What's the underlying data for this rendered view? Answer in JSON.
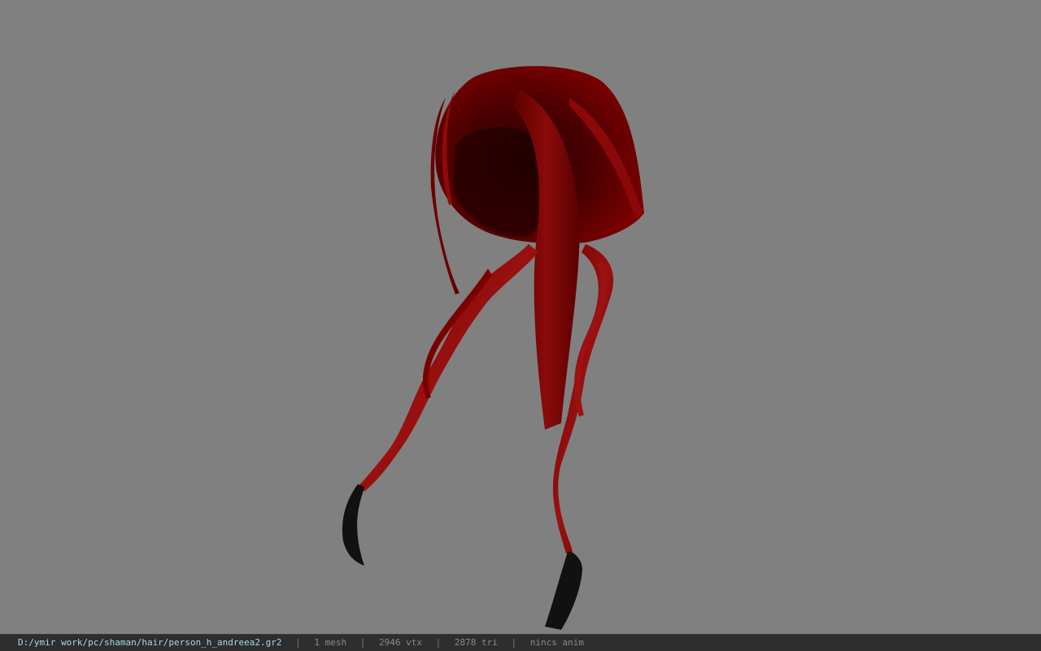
{
  "viewer": {
    "background_color": "#808080",
    "model": {
      "hair_color": "#7a0000",
      "tip_color": "#111111"
    }
  },
  "statusbar": {
    "file_path": "D:/ymir work/pc/shaman/hair/person_h_andreea2.gr2",
    "mesh_count": "1 mesh",
    "vertex_count": "2946 vtx",
    "triangle_count": "2878 tri",
    "anim_status": "nincs anim",
    "separator": "|"
  }
}
